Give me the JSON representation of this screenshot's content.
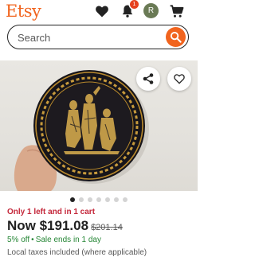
{
  "header": {
    "logo": "Etsy",
    "notification_count": "1",
    "avatar_initial": "R",
    "icons": [
      "heart-icon",
      "bell-icon",
      "cart-icon"
    ]
  },
  "search": {
    "placeholder": "Search",
    "value": ""
  },
  "carousel": {
    "total": 7,
    "active_index": 0
  },
  "product": {
    "stock_notice": "Only 1 left and in 1 cart",
    "price_now": "Now $191.08",
    "price_was": "$201.14",
    "discount": "5% off",
    "sale_separator": "•",
    "sale_notice": "Sale ends in 1 day",
    "tax_note": "Local taxes included (where applicable)"
  },
  "colors": {
    "brand": "#F1641E",
    "stock_red": "#C4273A",
    "sale_green": "#258635",
    "badge": "#E5411F"
  }
}
